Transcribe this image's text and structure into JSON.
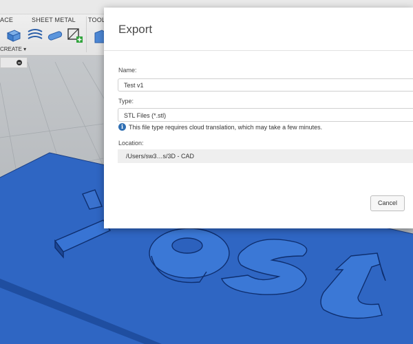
{
  "toolbar": {
    "tabs": [
      "ACE",
      "SHEET METAL",
      "TOOLS"
    ],
    "create_label": "CREATE ▾",
    "icons": [
      "extrude-icon",
      "coil-icon",
      "pipe-icon",
      "sketch-plus-icon",
      "solid-tool-icon"
    ]
  },
  "scene": {
    "model_text": "test",
    "plate_color": "#2f66c3"
  },
  "dialog": {
    "title": "Export",
    "name_label": "Name:",
    "name_value": "Test v1",
    "type_label": "Type:",
    "type_value": "STL Files (*.stl)",
    "info_text": "This file type requires cloud translation, which may take a few minutes.",
    "location_label": "Location:",
    "location_value": "/Users/sw3…s/3D - CAD",
    "cancel_label": "Cancel"
  }
}
